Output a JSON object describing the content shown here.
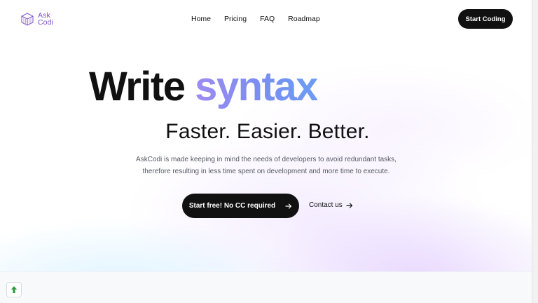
{
  "header": {
    "logo_text": "Ask\nCodi",
    "logo_icon": "askcodi-cube-icon",
    "nav": [
      "Home",
      "Pricing",
      "FAQ",
      "Roadmap"
    ],
    "cta": "Start Coding"
  },
  "hero": {
    "title_plain": "Write",
    "title_accent": "syntax",
    "subtitle": "Faster. Easier. Better.",
    "description_lines": [
      "AskCodi is made keeping in mind the needs of developers to avoid redundant tasks,",
      "therefore resulting in less time spent on development and more time to execute."
    ],
    "primary_cta": "Start free! No CC required",
    "secondary_cta": "Contact us"
  },
  "colors": {
    "brand": "#7b4fc6",
    "accent_gradient_start": "#9f8cf0",
    "accent_gradient_end": "#6b9cf4",
    "button_bg": "#111111",
    "scroll_up_icon": "#2f9e44"
  },
  "icons": {
    "primary_cta_icon": "arrow-right-icon",
    "secondary_cta_icon": "arrow-right-icon",
    "scroll_button_icon": "arrow-up-icon"
  }
}
